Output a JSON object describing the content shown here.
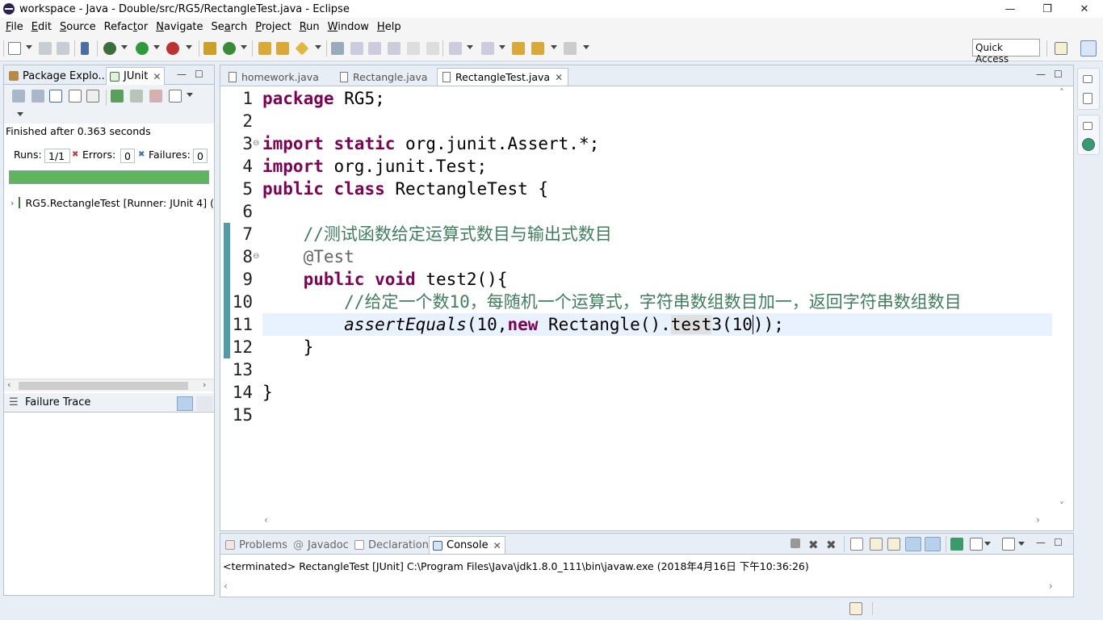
{
  "window": {
    "title": "workspace - Java - Double/src/RG5/RectangleTest.java - Eclipse",
    "min": "—",
    "restore": "❐",
    "close": "✕"
  },
  "menu": [
    {
      "acc": "F",
      "rest": "ile"
    },
    {
      "acc": "E",
      "rest": "dit"
    },
    {
      "acc": "S",
      "rest": "ource"
    },
    {
      "pre": "Refac",
      "acc": "t",
      "rest": "or"
    },
    {
      "acc": "N",
      "rest": "avigate"
    },
    {
      "pre": "Se",
      "acc": "a",
      "rest": "rch"
    },
    {
      "acc": "P",
      "rest": "roject"
    },
    {
      "acc": "R",
      "rest": "un"
    },
    {
      "acc": "W",
      "rest": "indow"
    },
    {
      "acc": "H",
      "rest": "elp"
    }
  ],
  "toolbar": {
    "quick_access": "Quick Access"
  },
  "left_panel": {
    "tabs": [
      "Package Explo...",
      "JUnit"
    ],
    "status": "Finished after 0.363 seconds",
    "runs_label": "Runs:",
    "runs_value": "1/1",
    "errors_label": "Errors:",
    "errors_value": "0",
    "failures_label": "Failures:",
    "failures_value": "0",
    "progress_fraction": 1.0,
    "progress_color": "#5fb55f",
    "tree_item": "RG5.RectangleTest [Runner: JUnit 4] (",
    "failure_trace_label": "Failure Trace"
  },
  "editor": {
    "tabs": [
      "homework.java",
      "Rectangle.java",
      "RectangleTest.java"
    ],
    "active_tab": "RectangleTest.java",
    "line_numbers": [
      "1",
      "2",
      "3",
      "4",
      "5",
      "6",
      "7",
      "8",
      "9",
      "10",
      "11",
      "12",
      "13",
      "14",
      "15"
    ],
    "code": {
      "l1_kw": "package",
      "l1_rest": " RG5;",
      "l3_kw1": "import",
      "l3_kw2": "static",
      "l3_rest": " org.junit.Assert.*;",
      "l4_kw": "import",
      "l4_rest": " org.junit.Test;",
      "l5_kw1": "public",
      "l5_kw2": "class",
      "l5_rest": " RectangleTest {",
      "l7_comment": "//测试函数给定运算式数目与输出式数目",
      "l8_annotation": "@Test",
      "l9_kw1": "public",
      "l9_kw2": "void",
      "l9_rest": " test2(){",
      "l10_comment_a": "//给定一个数",
      "l10_comment_num": "10",
      "l10_comment_b": "，每随机一个运算式，字符串数组数目加一，返回字符串数组数目",
      "l11_method": "assertEquals",
      "l11_a": "(10,",
      "l11_kw": "new",
      "l11_b": " Rectangle().",
      "l11_occ": "test",
      "l11_c": "3(10",
      "l11_d": "));",
      "l12": "}",
      "l14": "}"
    }
  },
  "bottom_panel": {
    "tabs": [
      "Problems",
      "Javadoc",
      "Declaration",
      "Console"
    ],
    "active_tab": "Console",
    "console_text": "<terminated> RectangleTest [JUnit] C:\\Program Files\\Java\\jdk1.8.0_111\\bin\\javaw.exe (2018年4月16日 下午10:36:26)"
  },
  "icons": {
    "close": "✕",
    "minimize": "—",
    "maximize": "☐",
    "arrow_right": "›",
    "arrow_left": "‹",
    "fold": "⊖",
    "chevron_up": "˄",
    "chevron_down": "˅",
    "lines": "☰"
  }
}
